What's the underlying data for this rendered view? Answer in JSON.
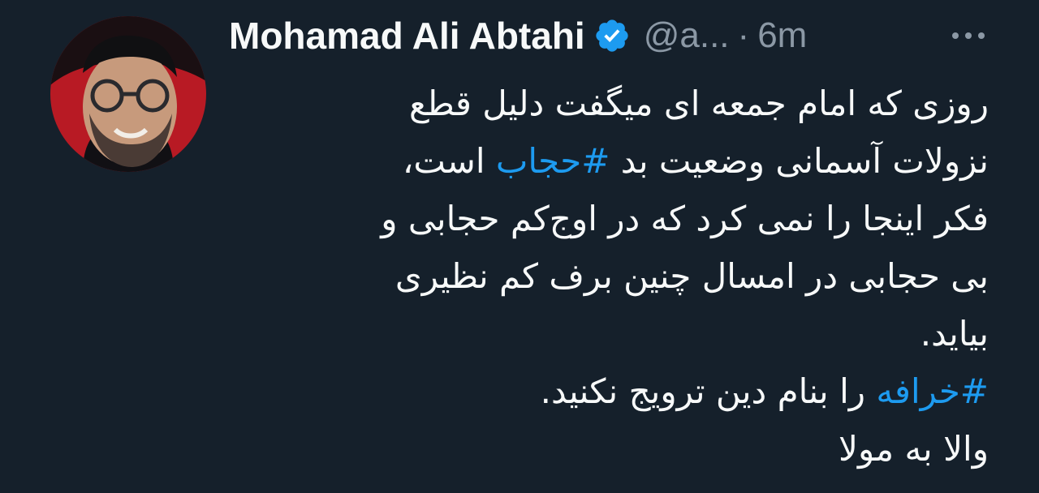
{
  "author": {
    "name": "Mohamad Ali Abtahi",
    "handle": "@a...",
    "separator": "·",
    "time": "6m",
    "verified": true
  },
  "icons": {
    "avatar": "avatar-photo",
    "verified": "verified-badge-icon",
    "more": "more-options-icon"
  },
  "colors": {
    "background": "#15202b",
    "text": "#f7f9f9",
    "secondary": "#8b98a5",
    "link": "#1d9bf0",
    "verified_badge": "#1d9bf0"
  },
  "tweet": {
    "line1": "روزی که امام جمعه ای میگفت دلیل قطع",
    "line2_pre": "نزولات آسمانی وضعیت بد ",
    "line2_hashtag": "#حجاب",
    "line2_post": " است،",
    "line3": "فکر اینجا را نمی کرد که در اوج‌کم حجابی و",
    "line4": "بی حجابی در امسال چنین برف کم نظیری",
    "line5": "بیاید.",
    "line6_hashtag": "#خرافه",
    "line6_post": " را بنام دین ترویج نکنید.",
    "line7": "والا به مولا"
  }
}
